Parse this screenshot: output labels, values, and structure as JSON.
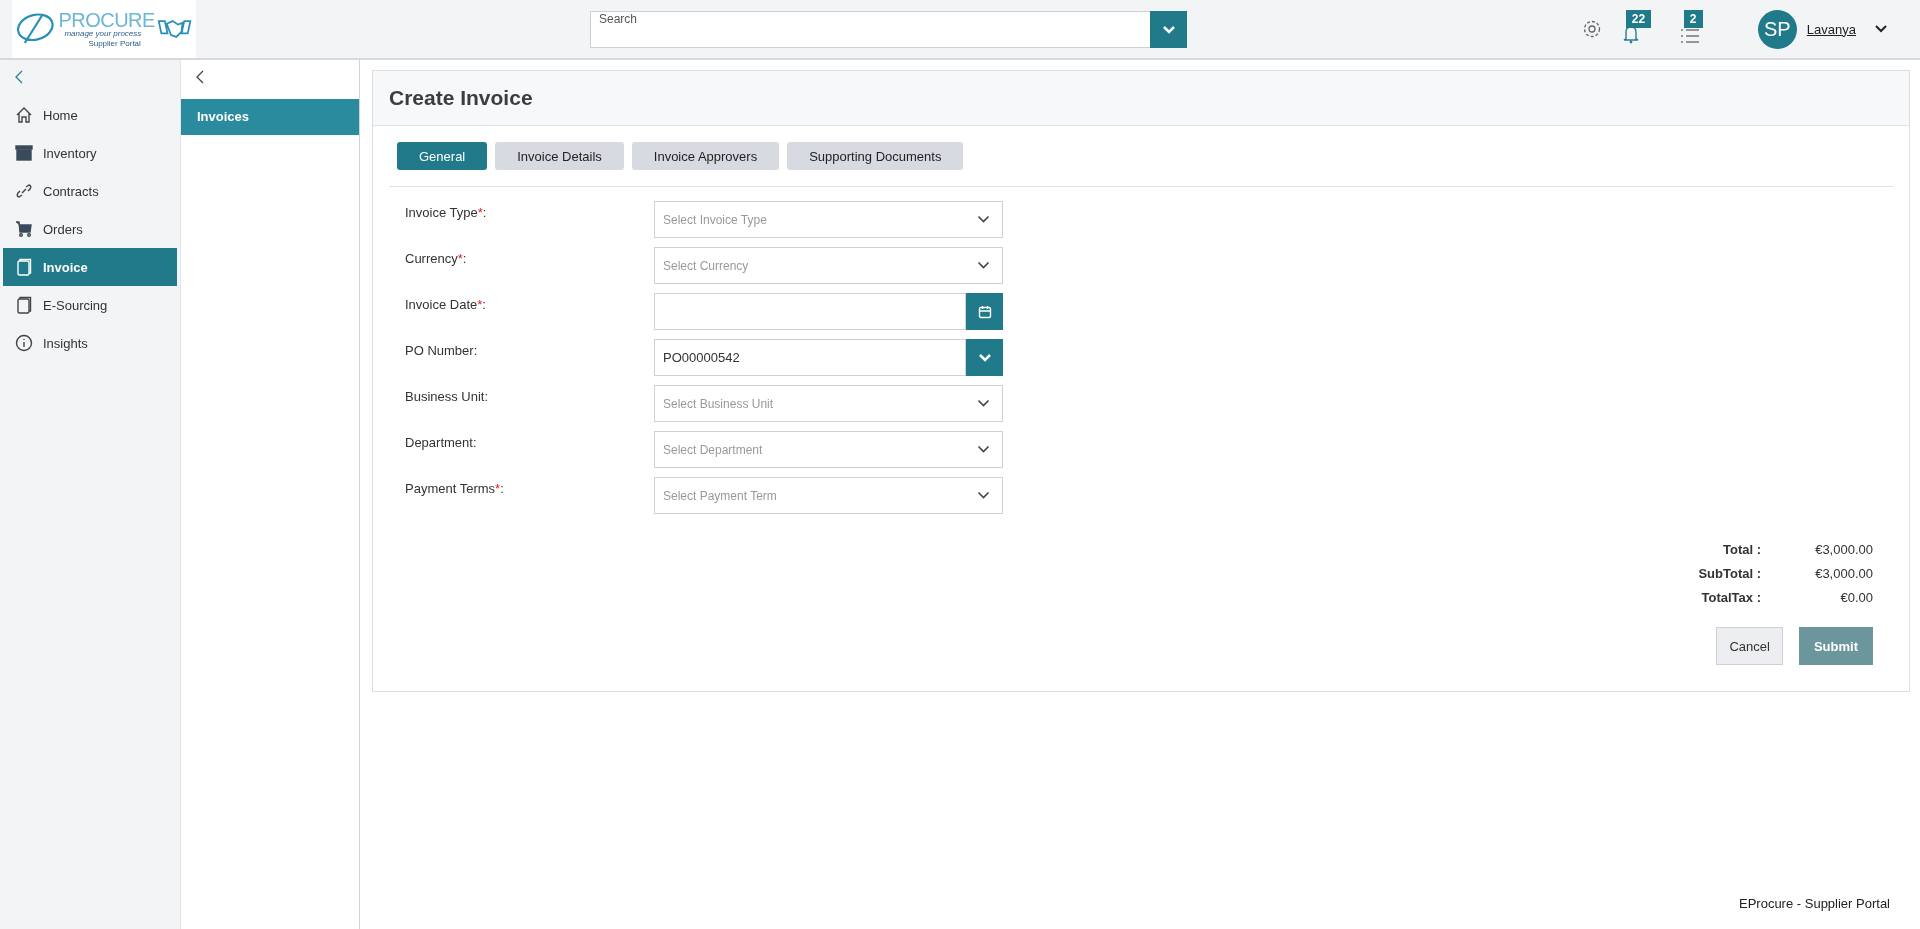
{
  "logo": {
    "wordmark": "PROCURE",
    "tagline": "manage your process",
    "subtitle": "Supplier Portal"
  },
  "search": {
    "placeholder": "Search"
  },
  "header": {
    "notifications": "22",
    "tasks": "2",
    "avatar": "SP",
    "user": "Lavanya"
  },
  "sidebar": {
    "items": [
      {
        "label": "Home",
        "selected": false
      },
      {
        "label": "Inventory",
        "selected": false
      },
      {
        "label": "Contracts",
        "selected": false
      },
      {
        "label": "Orders",
        "selected": false
      },
      {
        "label": "Invoice",
        "selected": true
      },
      {
        "label": "E-Sourcing",
        "selected": false
      },
      {
        "label": "Insights",
        "selected": false
      }
    ]
  },
  "subnav": {
    "items": [
      {
        "label": "Invoices",
        "selected": true
      }
    ]
  },
  "page": {
    "title": "Create Invoice"
  },
  "tabs": [
    {
      "label": "General",
      "selected": true
    },
    {
      "label": "Invoice Details",
      "selected": false
    },
    {
      "label": "Invoice Approvers",
      "selected": false
    },
    {
      "label": "Supporting Documents",
      "selected": false
    }
  ],
  "fields": [
    {
      "kind": "select",
      "label": "Invoice Type",
      "required_mark": "*",
      "label_end": ":",
      "placeholder": "Select Invoice Type"
    },
    {
      "kind": "select",
      "label": "Currency",
      "required_mark": "*",
      "label_end": ":",
      "placeholder": "Select Currency"
    },
    {
      "kind": "date",
      "label": "Invoice Date",
      "required_mark": "*",
      "label_end": ":"
    },
    {
      "kind": "lookup",
      "label": "PO Number:",
      "value": "PO00000542"
    },
    {
      "kind": "select",
      "label": "Business Unit:",
      "placeholder": "Select Business Unit"
    },
    {
      "kind": "select",
      "label": "Department:",
      "placeholder": "Select Department"
    },
    {
      "kind": "select",
      "label": "Payment Terms",
      "required_mark": "*",
      "label_end": ":",
      "placeholder": "Select Payment Term"
    }
  ],
  "totals": [
    {
      "label": "Total :",
      "value": "€3,000.00"
    },
    {
      "label": "SubTotal :",
      "value": "€3,000.00"
    },
    {
      "label": "TotalTax :",
      "value": "€0.00"
    }
  ],
  "buttons": [
    {
      "kind": "secondary",
      "label": "Cancel"
    },
    {
      "kind": "primary",
      "label": "Submit"
    }
  ],
  "footer": "EProcure - Supplier Portal"
}
